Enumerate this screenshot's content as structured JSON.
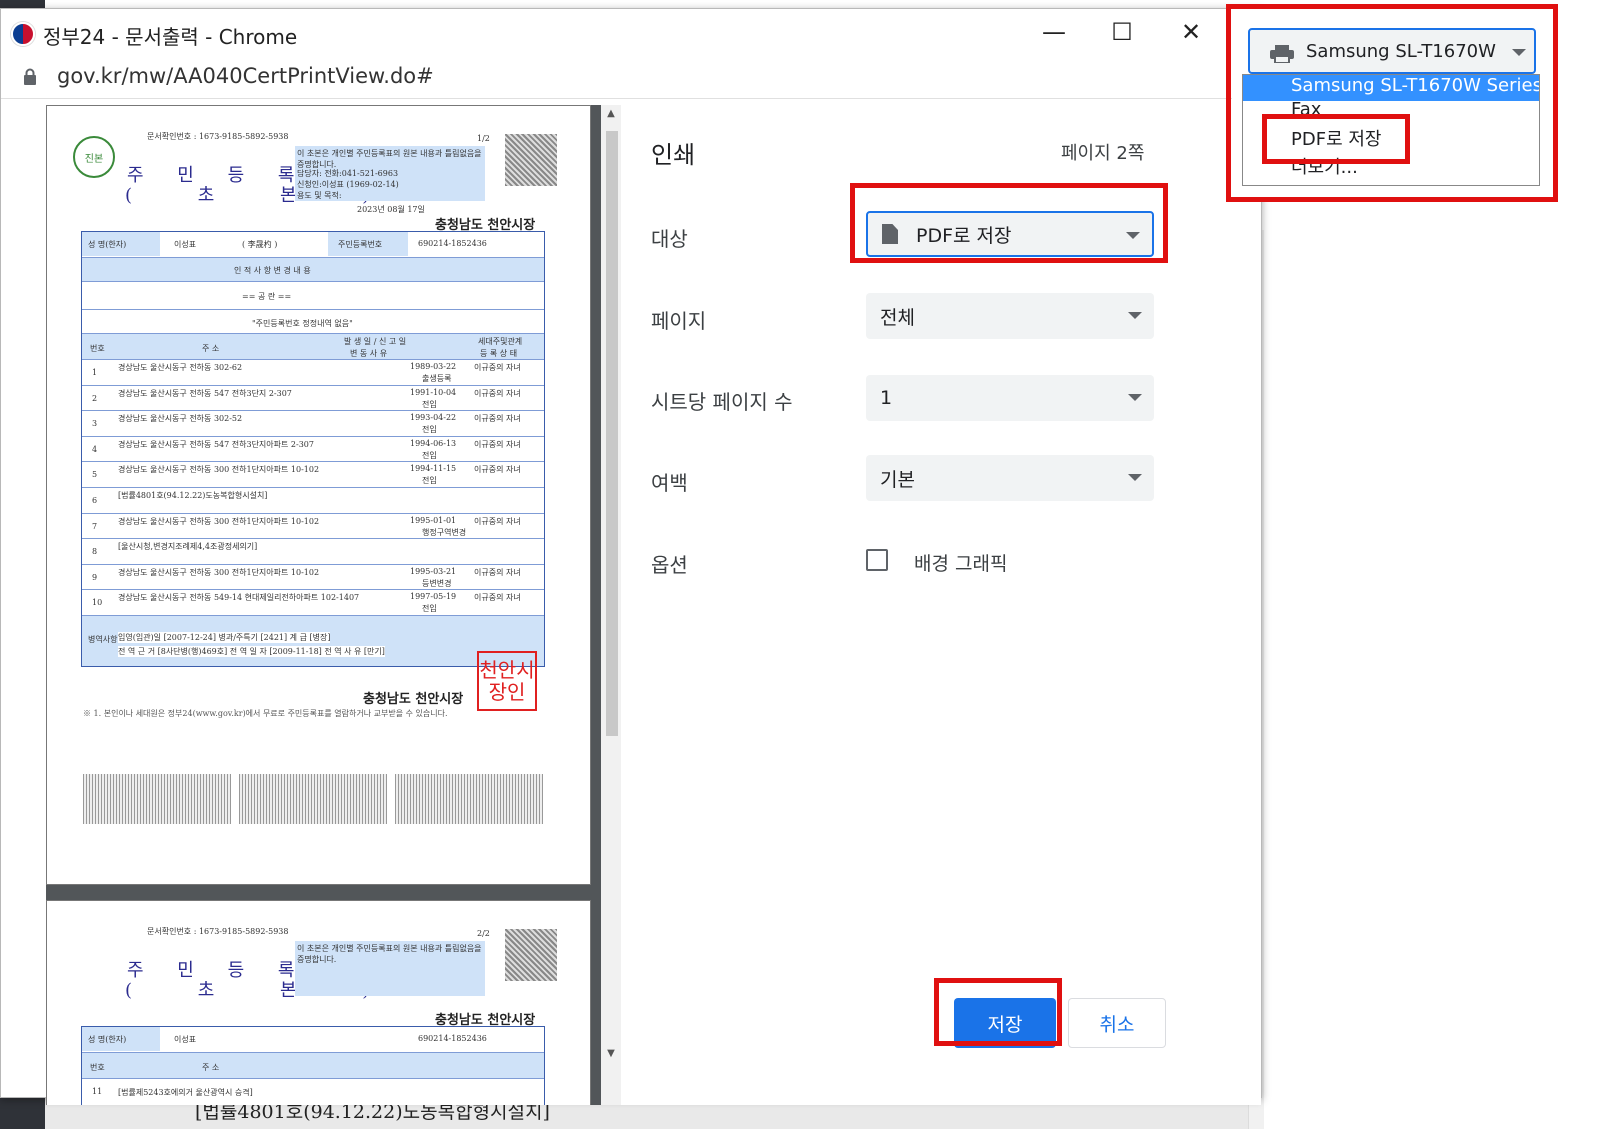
{
  "window": {
    "title": "정부24 - 문서출력 - Chrome",
    "url": "gov.kr/mw/AA040CertPrintView.do#",
    "minimize_glyph": "—",
    "maximize_glyph": "☐",
    "close_glyph": "✕"
  },
  "background": {
    "bottom_text": "[법률4801호(94.12.22)도농복합형시설치]"
  },
  "document": {
    "confirm_no": "문서확인번호 : 1673-9185-5892-5938",
    "page_no_1": "1/2",
    "page_no_2": "2/2",
    "title": "주 민 등 록 표",
    "subtitle": "( 초 본 )",
    "notice": "이 초본은 개인별 주민등록표의 원본 내용과 틀림없음을 증명합니다.",
    "contact": "담당자:           전화:041-521-6963",
    "applicant": "신청인:이성표       (1969-02-14)",
    "purpose": "용도 및 목적:",
    "date": "2023년 08월 17일",
    "issuer": "충청남도 천안시장",
    "name_label": "성 명(한자)",
    "name_value": "이성표",
    "hanja": "( 李晟杓 )",
    "rrn_label": "주민등록번호",
    "rrn_value": "690214-1852436",
    "section_header": "인 적 사 항 변 경 내 용",
    "blank": "== 공 란 ==",
    "no_change": "\"주민등록번호 정정내역 없음\"",
    "col_no": "번호",
    "col_addr": "주 소",
    "col_date": "발 생 일 / 신 고 일",
    "col_reason": "변 동 사 유",
    "col_relation": "세대주및관계",
    "col_status": "등 록 상 태",
    "rows": [
      {
        "no": "1",
        "addr": "경상남도 울산시동구 전하동 302-62",
        "date": "1989-03-22",
        "reason": "출생등록",
        "rel": "이규중의 자녀"
      },
      {
        "no": "2",
        "addr": "경상남도 울산시동구 전하동 547 전하3단지 2-307",
        "date": "1991-10-04",
        "reason": "전입",
        "rel": "이규중의 자녀"
      },
      {
        "no": "3",
        "addr": "경상남도 울산시동구 전하동 302-52",
        "date": "1993-04-22",
        "reason": "전입",
        "rel": "이규중의 자녀"
      },
      {
        "no": "4",
        "addr": "경상남도 울산시동구 전하동 547 전하3단지아파트 2-307",
        "date": "1994-06-13",
        "reason": "전입",
        "rel": "이규중의 자녀"
      },
      {
        "no": "5",
        "addr": "경상남도 울산시동구 전하동 300 전하1단지아파트 10-102",
        "date": "1994-11-15",
        "reason": "전입",
        "rel": "이규중의 자녀"
      },
      {
        "no": "6",
        "addr": "[법률4801호(94.12.22)도농복합형시설치]",
        "date": "",
        "reason": "",
        "rel": ""
      },
      {
        "no": "7",
        "addr": "경상남도 울산시동구 전하동 300 전하1단지아파트 10-102",
        "date": "1995-01-01",
        "reason": "행정구역변경",
        "rel": "이규중의 자녀"
      },
      {
        "no": "8",
        "addr": "[울산시청,변경지조례제4,4조광정세의기]",
        "date": "",
        "reason": "",
        "rel": ""
      },
      {
        "no": "9",
        "addr": "경상남도 울산시동구 전하동 300 전하1단지아파트 10-102",
        "date": "1995-03-21",
        "reason": "등변변경",
        "rel": "이규중의 자녀"
      },
      {
        "no": "10",
        "addr": "경상남도 울산시동구 전하동 549-14 현대제일리전하아파트 102-1407",
        "date": "1997-05-19",
        "reason": "전입",
        "rel": "이규중의 자녀"
      }
    ],
    "military_label": "병역사항",
    "military_1": "입영(임관)일 [2007-12-24]   병과/주특기 [2421]   계 급 [병장]",
    "military_2": "전 역 근 거 [8사단병(행)469호]   전 역 일 자 [2009-11-18]   전 역 사 유 [만기]",
    "stamp_text": "천안시장인",
    "footnote": "※ 1. 본인이나 세대원은 정부24(www.gov.kr)에서 무료로 주민등록표를 열람하거나 교부받을 수 있습니다.",
    "page2_row": "[법률제5243호에의거 울산광역시 승격]",
    "page2_row_no": "11"
  },
  "print_settings": {
    "heading": "인쇄",
    "page_count": "페이지 2쪽",
    "destination_label": "대상",
    "destination_value": "PDF로 저장",
    "pages_label": "페이지",
    "pages_value": "전체",
    "pages_per_sheet_label": "시트당 페이지 수",
    "pages_per_sheet_value": "1",
    "margins_label": "여백",
    "margins_value": "기본",
    "options_label": "옵션",
    "background_graphics_label": "배경 그래픽",
    "background_graphics_checked": false,
    "save_label": "저장",
    "cancel_label": "취소",
    "accent_color": "#1a73e8",
    "highlight_color": "#e01010"
  },
  "dropdown_inset": {
    "selected_value": "Samsung SL-T1670W",
    "options": [
      "Samsung SL-T1670W Series",
      "Fax",
      "PDF로 저장",
      "더보기..."
    ],
    "highlighted_index": 0,
    "icon": "printer-icon"
  }
}
